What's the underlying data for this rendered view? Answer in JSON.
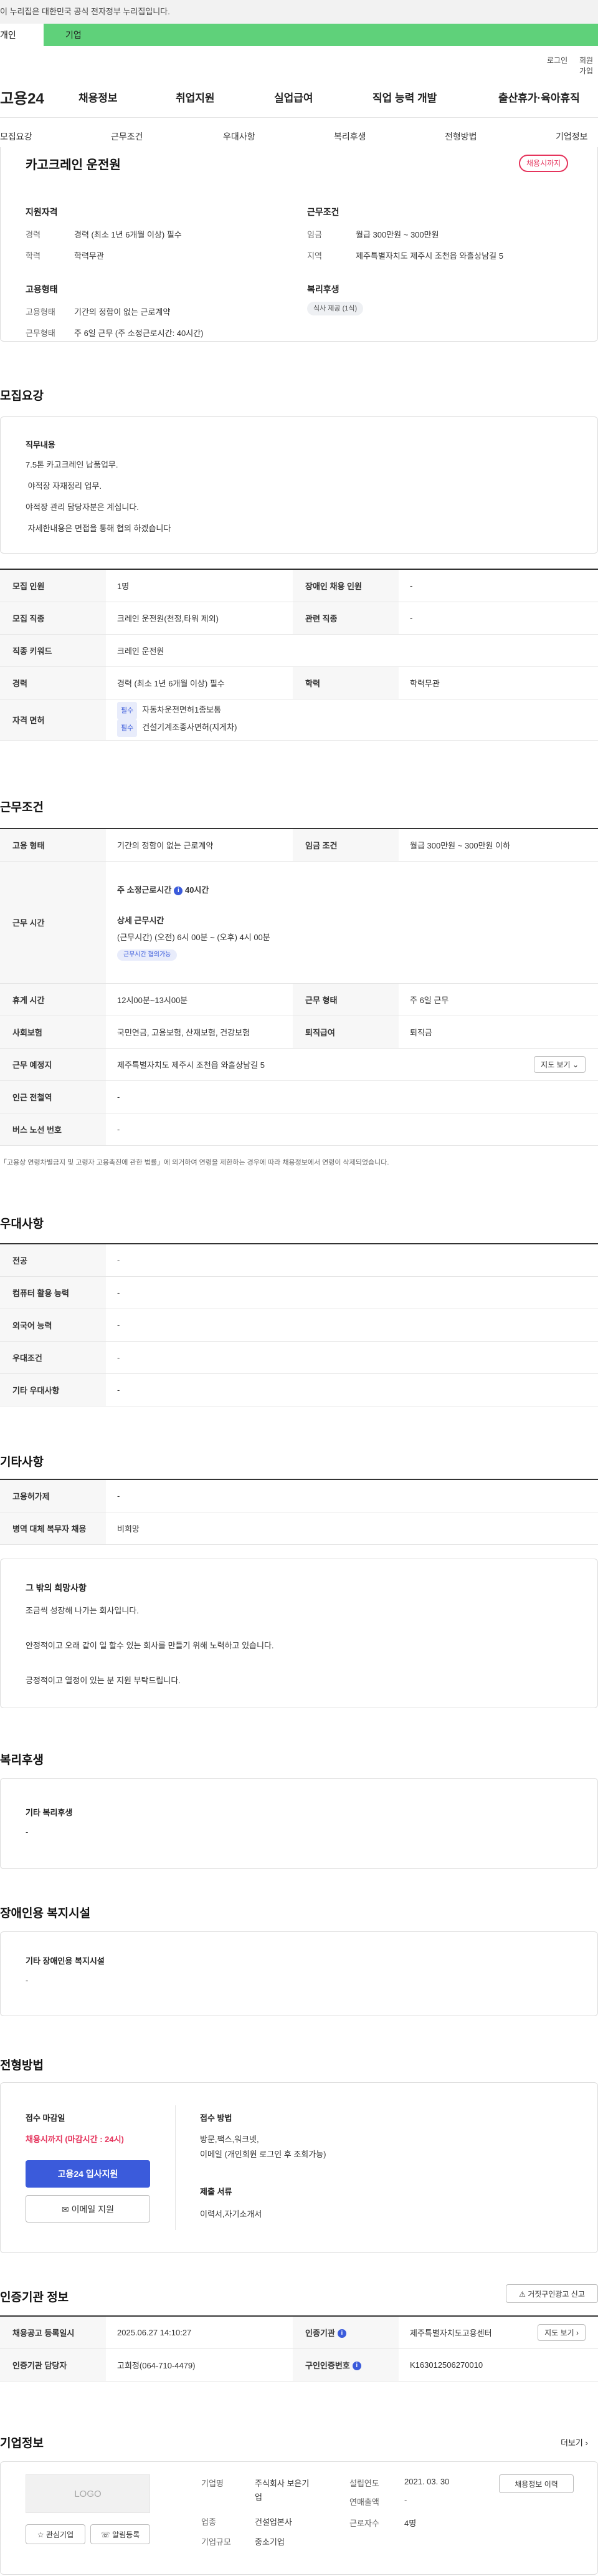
{
  "gov_banner": "이 누리집은 대한민국 공식 전자정부 누리집입니다.",
  "gov_tabs": {
    "personal": "개인",
    "business": "기업"
  },
  "util": {
    "login": "로그인",
    "signup": "회원가입"
  },
  "brand": "고용24",
  "gnb": [
    "채용정보",
    "취업지원",
    "실업급여",
    "직업 능력 개발",
    "출산휴가·육아휴직"
  ],
  "sub_nav": [
    "모집요강",
    "근무조건",
    "우대사항",
    "복리후생",
    "전형방법",
    "기업정보"
  ],
  "job": {
    "title": "카고크레인 운전원",
    "status_badge": "채용시까지",
    "summary": {
      "qual_title": "지원자격",
      "career_label": "경력",
      "career_value": "경력 (최소 1년 6개월 이상) 필수",
      "edu_label": "학력",
      "edu_value": "학력무관",
      "cond_title": "근무조건",
      "wage_label": "임금",
      "wage_value": "월급 300만원 ~ 300만원",
      "region_label": "지역",
      "region_value": "제주특별자치도 제주시 조천읍 와흘상남길 5",
      "emp_title": "고용형태",
      "emp_type_label": "고용형태",
      "emp_type_value": "기간의 정함이 없는 근로계약",
      "work_form_label": "근무형태",
      "work_form_value": "주 6일 근무 (주 소정근로시간: 40시간)",
      "welfare_title": "복리후생",
      "welfare_chip": "식사 제공 (1식)"
    }
  },
  "recruit": {
    "section_title": "모집요강",
    "duty_title": "직무내용",
    "duty_lines": [
      "7.5톤 카고크레인 납품업무.",
      " 야적장 자재정리 업무.",
      "야적장 관리 담당자분은 계십니다.",
      " 자세한내용은 면접을 통해 협의 하겠습니다"
    ],
    "rows": {
      "count_label": "모집 인원",
      "count_value": "1명",
      "disabled_label": "장애인 채용 인원",
      "disabled_value": "-",
      "job_label": "모집 직종",
      "job_value": "크레인 운전원(천정,타워 제외)",
      "related_label": "관련 직종",
      "related_value": "-",
      "keyword_label": "직종 키워드",
      "keyword_value": "크레인 운전원",
      "career_label": "경력",
      "career_value": "경력 (최소 1년 6개월 이상) 필수",
      "edu_label": "학력",
      "edu_value": "학력무관",
      "license_label": "자격 면허",
      "license_req": "필수",
      "license_1": "자동차운전면허1종보통",
      "license_2": "건설기계조종사면허(지게차)"
    }
  },
  "conditions": {
    "section_title": "근무조건",
    "emp_label": "고용 형태",
    "emp_value": "기간의 정함이 없는 근로계약",
    "wage_label": "임금 조건",
    "wage_value": "월급 300만원 ~ 300만원 이하",
    "hours_label": "근무 시간",
    "hours_weekly": "주 소정근로시간",
    "hours_weekly_value": "40시간",
    "hours_detail_title": "상세 근무시간",
    "hours_detail": "(근무시간) (오전) 6시 00분 ~ (오후) 4시 00분",
    "hours_chip": "근무시간 협의가능",
    "break_label": "휴게 시간",
    "break_value": "12시00분~13시00분",
    "form_label": "근무 형태",
    "form_value": "주 6일 근무",
    "insurance_label": "사회보험",
    "insurance_value": "국민연금, 고용보험, 산재보험, 건강보험",
    "severance_label": "퇴직급여",
    "severance_value": "퇴직금",
    "place_label": "근무 예정지",
    "place_value": "제주특별자치도 제주시 조천읍 와흘상남길 5",
    "map_btn": "지도 보기",
    "subway_label": "인근 전철역",
    "subway_value": "-",
    "bus_label": "버스 노선 번호",
    "bus_value": "-",
    "note": "「고용상 연령차별금지 및 고령자 고용촉진에 관한 법률」에 의거하여 연령을 제한하는 경우에 따라 채용정보에서 연령이 삭제되었습니다."
  },
  "preference": {
    "section_title": "우대사항",
    "major_label": "전공",
    "major_value": "-",
    "computer_label": "컴퓨터 활용 능력",
    "computer_value": "-",
    "lang_label": "외국어 능력",
    "lang_value": "-",
    "cond_label": "우대조건",
    "cond_value": "-",
    "etc_label": "기타 우대사항",
    "etc_value": "-"
  },
  "etc": {
    "section_title": "기타사항",
    "employ_label": "고용허가제",
    "employ_value": "-",
    "military_label": "병역 대체 복무자 채용",
    "military_value": "비희망",
    "wish_title": "그 밖의 희망사항",
    "wish_lines": [
      "조금씩 성장해 나가는 회사입니다.",
      "안정적이고 오래 같이 일 할수 있는 회사를 만들기 위해 노력하고 있습니다.",
      "긍정적이고 열정이 있는 분 지원 부탁드립니다."
    ]
  },
  "welfare": {
    "section_title": "복리후생",
    "box_title": "기타 복리후생",
    "box_value": "-"
  },
  "disabled": {
    "section_title": "장애인용 복지시설",
    "box_title": "기타 장애인용 복지시설",
    "box_value": "-"
  },
  "selection": {
    "section_title": "전형방법",
    "deadline_label": "접수 마감일",
    "deadline_value": "채용시까지 (마감시간 : 24시)",
    "apply_btn": "고용24 입사지원",
    "email_btn": "이메일 지원",
    "method_title": "접수 방법",
    "method_value_1": "방문,팩스,워크넷,",
    "method_value_2": "이메일 (개인회원 로그인 후 조회가능)",
    "docs_title": "제출 서류",
    "docs_value": "이력서,자기소개서"
  },
  "cert": {
    "section_title": "인증기관 정보",
    "report_btn": "거짓구인광고 신고",
    "reg_label": "채용공고 등록일시",
    "reg_value": "2025.06.27 14:10:27",
    "org_label": "인증기관",
    "org_value": "제주특별자치도고용센터",
    "manager_label": "인증기관 담당자",
    "manager_value": "고희정(064-710-4479)",
    "id_label": "구인인증번호",
    "id_value": "K163012506270010",
    "map_btn": "지도 보기"
  },
  "company": {
    "section_title": "기업정보",
    "more": "더보기",
    "logo": "LOGO",
    "fav_btn": "관심기업",
    "alarm_btn": "알림등록",
    "type_label": "기업명",
    "type_value_1": "주식회사 보은기",
    "type_value_2": "업",
    "industry_label": "업종",
    "industry_value": "건설업본사",
    "scale_label": "기업규모",
    "scale_value": "중소기업",
    "founded_label": "설립연도",
    "founded_value": "2021. 03. 30",
    "sales_label": "연매출액",
    "sales_value": "-",
    "employees_label": "근로자수",
    "employees_value": "4명",
    "jobs_btn": "채용정보 이력"
  }
}
